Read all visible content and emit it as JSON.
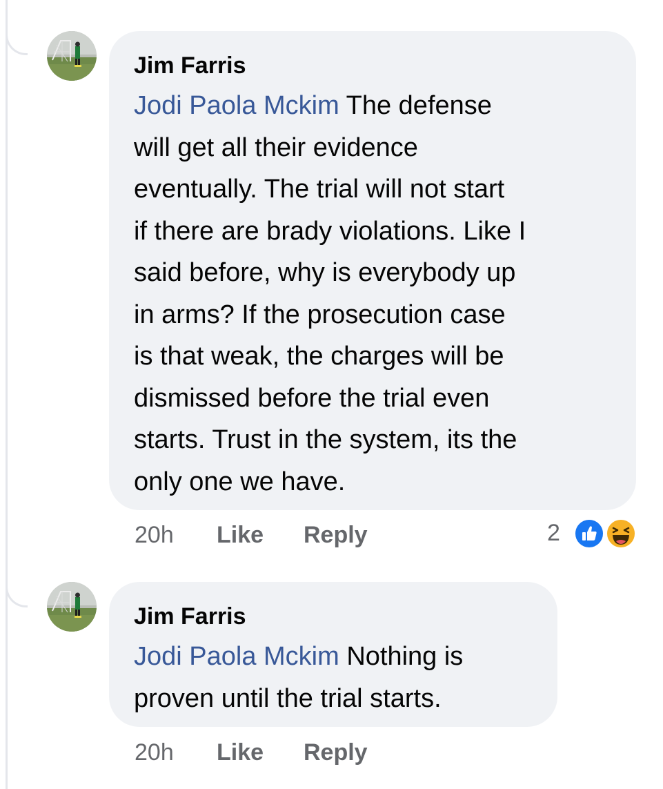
{
  "comments": [
    {
      "author": "Jim Farris",
      "mention": "Jodi Paola Mckim",
      "lines": [
        "The defense",
        "will get all their evidence",
        "eventually. The trial will not start",
        "if there are brady violations. Like I",
        "said before, why is everybody up",
        "in arms? If the prosecution case",
        "is that weak, the charges will be",
        "dismissed before the trial even",
        "starts. Trust in the system, its the",
        "only one we have."
      ],
      "time": "20h",
      "like_label": "Like",
      "reply_label": "Reply",
      "reaction_count": "2",
      "reactions": [
        "like-reaction-icon",
        "haha-reaction-icon"
      ]
    },
    {
      "author": "Jim Farris",
      "mention": "Jodi Paola Mckim",
      "lines": [
        "Nothing is",
        "proven until the trial starts."
      ],
      "time": "20h",
      "like_label": "Like",
      "reply_label": "Reply"
    }
  ],
  "colors": {
    "mention": "#385898",
    "bubble": "#f0f2f5",
    "meta": "#65676b",
    "like_reaction": "#1877f2",
    "haha_reaction": "#f7b125"
  }
}
